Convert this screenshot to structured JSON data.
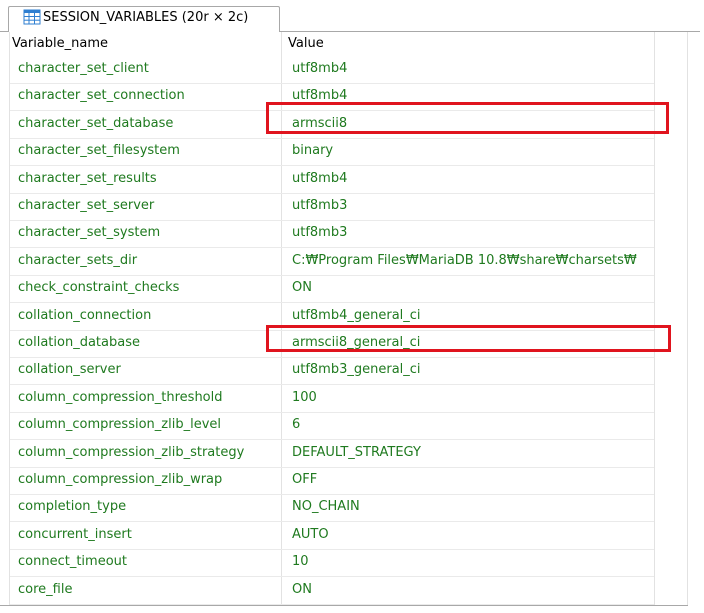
{
  "tab": {
    "label": "SESSION_VARIABLES (20r × 2c)",
    "icon": "table-icon"
  },
  "table": {
    "columns": [
      "Variable_name",
      "Value"
    ],
    "rows": [
      {
        "name": "character_set_client",
        "value": "utf8mb4"
      },
      {
        "name": "character_set_connection",
        "value": "utf8mb4"
      },
      {
        "name": "character_set_database",
        "value": "armscii8"
      },
      {
        "name": "character_set_filesystem",
        "value": "binary"
      },
      {
        "name": "character_set_results",
        "value": "utf8mb4"
      },
      {
        "name": "character_set_server",
        "value": "utf8mb3"
      },
      {
        "name": "character_set_system",
        "value": "utf8mb3"
      },
      {
        "name": "character_sets_dir",
        "value": "C:₩Program Files₩MariaDB 10.8₩share₩charsets₩"
      },
      {
        "name": "check_constraint_checks",
        "value": "ON"
      },
      {
        "name": "collation_connection",
        "value": "utf8mb4_general_ci"
      },
      {
        "name": "collation_database",
        "value": "armscii8_general_ci"
      },
      {
        "name": "collation_server",
        "value": "utf8mb3_general_ci"
      },
      {
        "name": "column_compression_threshold",
        "value": "100"
      },
      {
        "name": "column_compression_zlib_level",
        "value": "6"
      },
      {
        "name": "column_compression_zlib_strategy",
        "value": "DEFAULT_STRATEGY"
      },
      {
        "name": "column_compression_zlib_wrap",
        "value": "OFF"
      },
      {
        "name": "completion_type",
        "value": "NO_CHAIN"
      },
      {
        "name": "concurrent_insert",
        "value": "AUTO"
      },
      {
        "name": "connect_timeout",
        "value": "10"
      },
      {
        "name": "core_file",
        "value": "ON"
      }
    ]
  },
  "colors": {
    "value_text": "#1f7a1f",
    "highlight_border": "#e0141e",
    "grid_line": "#e2e2e2"
  }
}
